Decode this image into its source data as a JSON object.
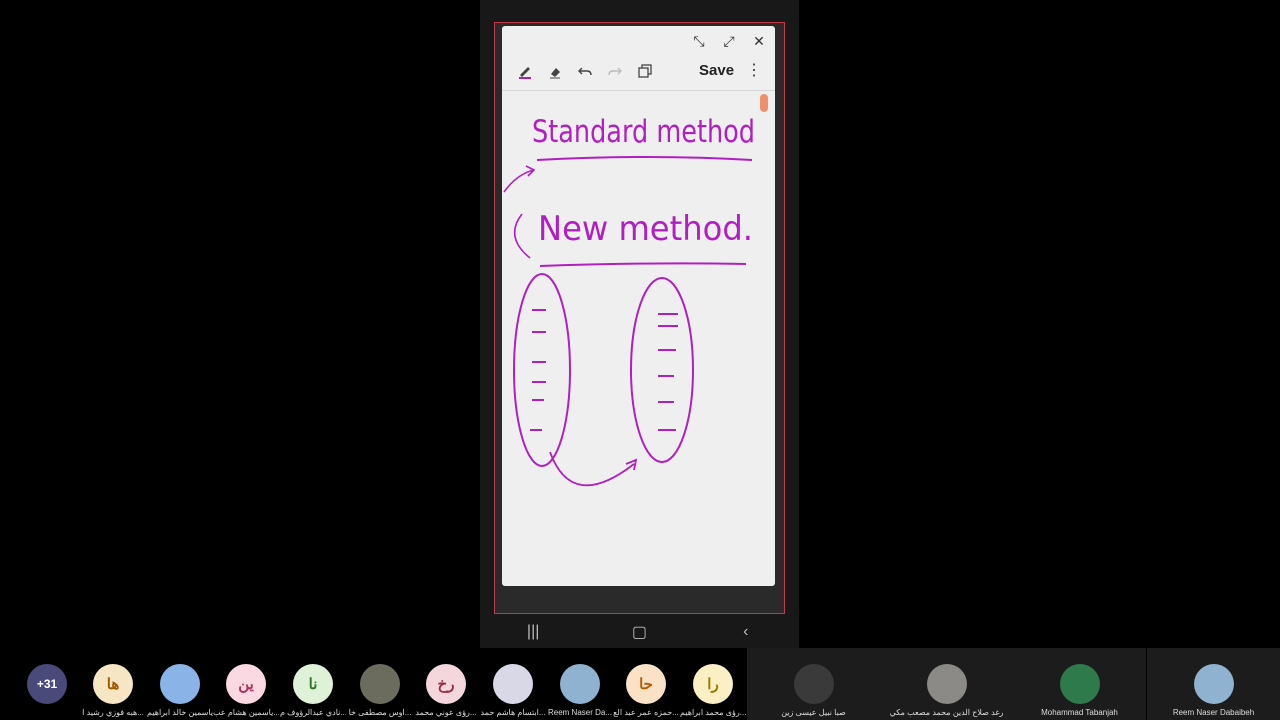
{
  "note_window": {
    "save_label": "Save",
    "more_label": "⋮",
    "controls": [
      "⤡",
      "⤢",
      "✕"
    ]
  },
  "handwriting": {
    "line1": "Standard method",
    "line2": "New method."
  },
  "android_nav": {
    "recent": "|||",
    "home": "▢",
    "back": "‹"
  },
  "participants": {
    "overflow_count": "+31",
    "small": [
      {
        "initials": "ها",
        "name": "هبه فوزي رشيد ا...",
        "bg": "#f7e6c4",
        "fg": "#a05a00"
      },
      {
        "initials": "",
        "name": "ياسمين خالد ابراهيم",
        "bg": "#8ab4e8",
        "fg": "#000"
      },
      {
        "initials": "ين",
        "name": "ياسمين هشام عب...",
        "bg": "#fbd9e2",
        "fg": "#b0305a"
      },
      {
        "initials": "نا",
        "name": "نادي عبدالرؤوف م...",
        "bg": "#dff2d8",
        "fg": "#2c7a2c"
      },
      {
        "initials": "",
        "name": "اوس مصطفى خا...",
        "bg": "#6b6b5e",
        "fg": "#000"
      },
      {
        "initials": "رخ",
        "name": "رؤى عوني محمد...",
        "bg": "#f3d7dc",
        "fg": "#9a2f45"
      },
      {
        "initials": "",
        "name": "ابتسام هاشم حمد...",
        "bg": "#d8d8e6",
        "fg": "#000"
      },
      {
        "initials": "",
        "name": "Reem Naser Da...",
        "bg": "#8fb2d0",
        "fg": "#000"
      },
      {
        "initials": "حا",
        "name": "حمزه عمر عبد الع...",
        "bg": "#fbe2c6",
        "fg": "#b85c00"
      },
      {
        "initials": "را",
        "name": "رؤى محمد ابراهيم...",
        "bg": "#fbefc4",
        "fg": "#9a7a00"
      }
    ],
    "large": [
      {
        "name": "صبا نبيل عيسى زين",
        "bg": "#3a3a3a"
      },
      {
        "name": "رغد صلاح الدين محمد مصعب مكي",
        "bg": "#8c8a86"
      },
      {
        "name": "Mohammad Tabanjah",
        "bg": "#2f7a4a"
      },
      {
        "name": "Reem Naser Dabaibeh",
        "bg": "#8fb2d0"
      }
    ]
  }
}
